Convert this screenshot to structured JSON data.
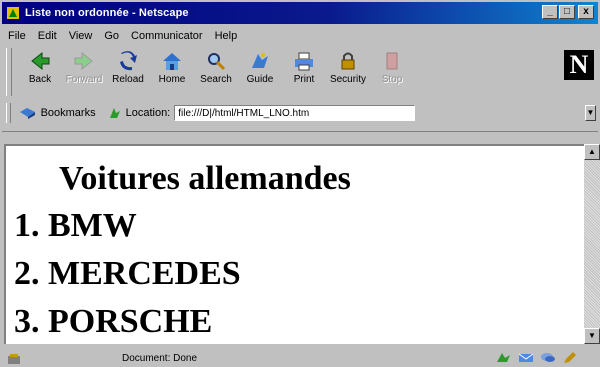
{
  "window": {
    "title": "Liste non ordonnée - Netscape",
    "buttons": [
      "_",
      "□",
      "x"
    ]
  },
  "menubar": [
    "File",
    "Edit",
    "View",
    "Go",
    "Communicator",
    "Help"
  ],
  "toolbar": [
    {
      "label": "Back",
      "icon": "back-icon",
      "disabled": false
    },
    {
      "label": "Forward",
      "icon": "forward-icon",
      "disabled": true
    },
    {
      "label": "Reload",
      "icon": "reload-icon",
      "disabled": false
    },
    {
      "label": "Home",
      "icon": "home-icon",
      "disabled": false
    },
    {
      "label": "Search",
      "icon": "search-icon",
      "disabled": false
    },
    {
      "label": "Guide",
      "icon": "guide-icon",
      "disabled": false
    },
    {
      "label": "Print",
      "icon": "print-icon",
      "disabled": false
    },
    {
      "label": "Security",
      "icon": "security-icon",
      "disabled": false
    },
    {
      "label": "Stop",
      "icon": "stop-icon",
      "disabled": true
    }
  ],
  "logo": "N",
  "location": {
    "bookmarks_label": "Bookmarks",
    "location_label": "Location:",
    "url": "file:///D|/html/HTML_LNO.htm"
  },
  "page": {
    "heading": "Voitures allemandes",
    "items": [
      "1. BMW",
      "2. MERCEDES",
      "3. PORSCHE"
    ]
  },
  "status": {
    "text": "Document: Done"
  },
  "colors": {
    "titlebar": "#000080",
    "chrome": "#c0c0c0",
    "content_bg": "#ffffff"
  }
}
